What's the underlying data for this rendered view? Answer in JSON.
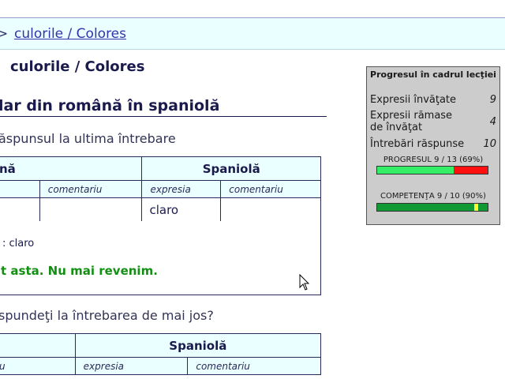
{
  "breadcrumb": {
    "separator": ">",
    "current_link": "culorile / Colores"
  },
  "page": {
    "title": "culorile / Colores"
  },
  "exercise": {
    "section_title": "lar din română în spaniolă",
    "last_answer_prompt": "ăspunsul la ultima întrebare",
    "table1": {
      "left_header": "nă",
      "right_header": "Spaniolă",
      "col_comment_left": "comentariu",
      "col_expression": "expresia",
      "col_comment_right": "comentariu",
      "expression_value": "claro"
    },
    "answer_line": ": claro",
    "feedback": "t asta. Nu mai revenim.",
    "next_prompt": "spundeţi la întrebarea de mai jos?",
    "table2": {
      "right_header": "Spaniolă",
      "col_left": "u",
      "col_expression": "expresia",
      "col_comment": "comentariu"
    }
  },
  "progress_panel": {
    "title": "Progresul în cadrul lecţiei",
    "rows": [
      {
        "label": "Expresii învăţate",
        "value": "9"
      },
      {
        "label": "Expresii rămase de învăţat",
        "value": "4"
      },
      {
        "label": "Întrebări răspunse",
        "value": "10"
      }
    ],
    "progress_label": "PROGRESUL 9 / 13 (69%)",
    "progress_fraction": 0.69,
    "competence_label": "COMPETENŢA 9 / 10 (90%)",
    "competence_fraction": 0.9,
    "colors": {
      "bar_green": "#33ee66",
      "bar_red": "#ff1111",
      "competence_green": "#119933",
      "competence_marker": "#ffff33"
    }
  }
}
